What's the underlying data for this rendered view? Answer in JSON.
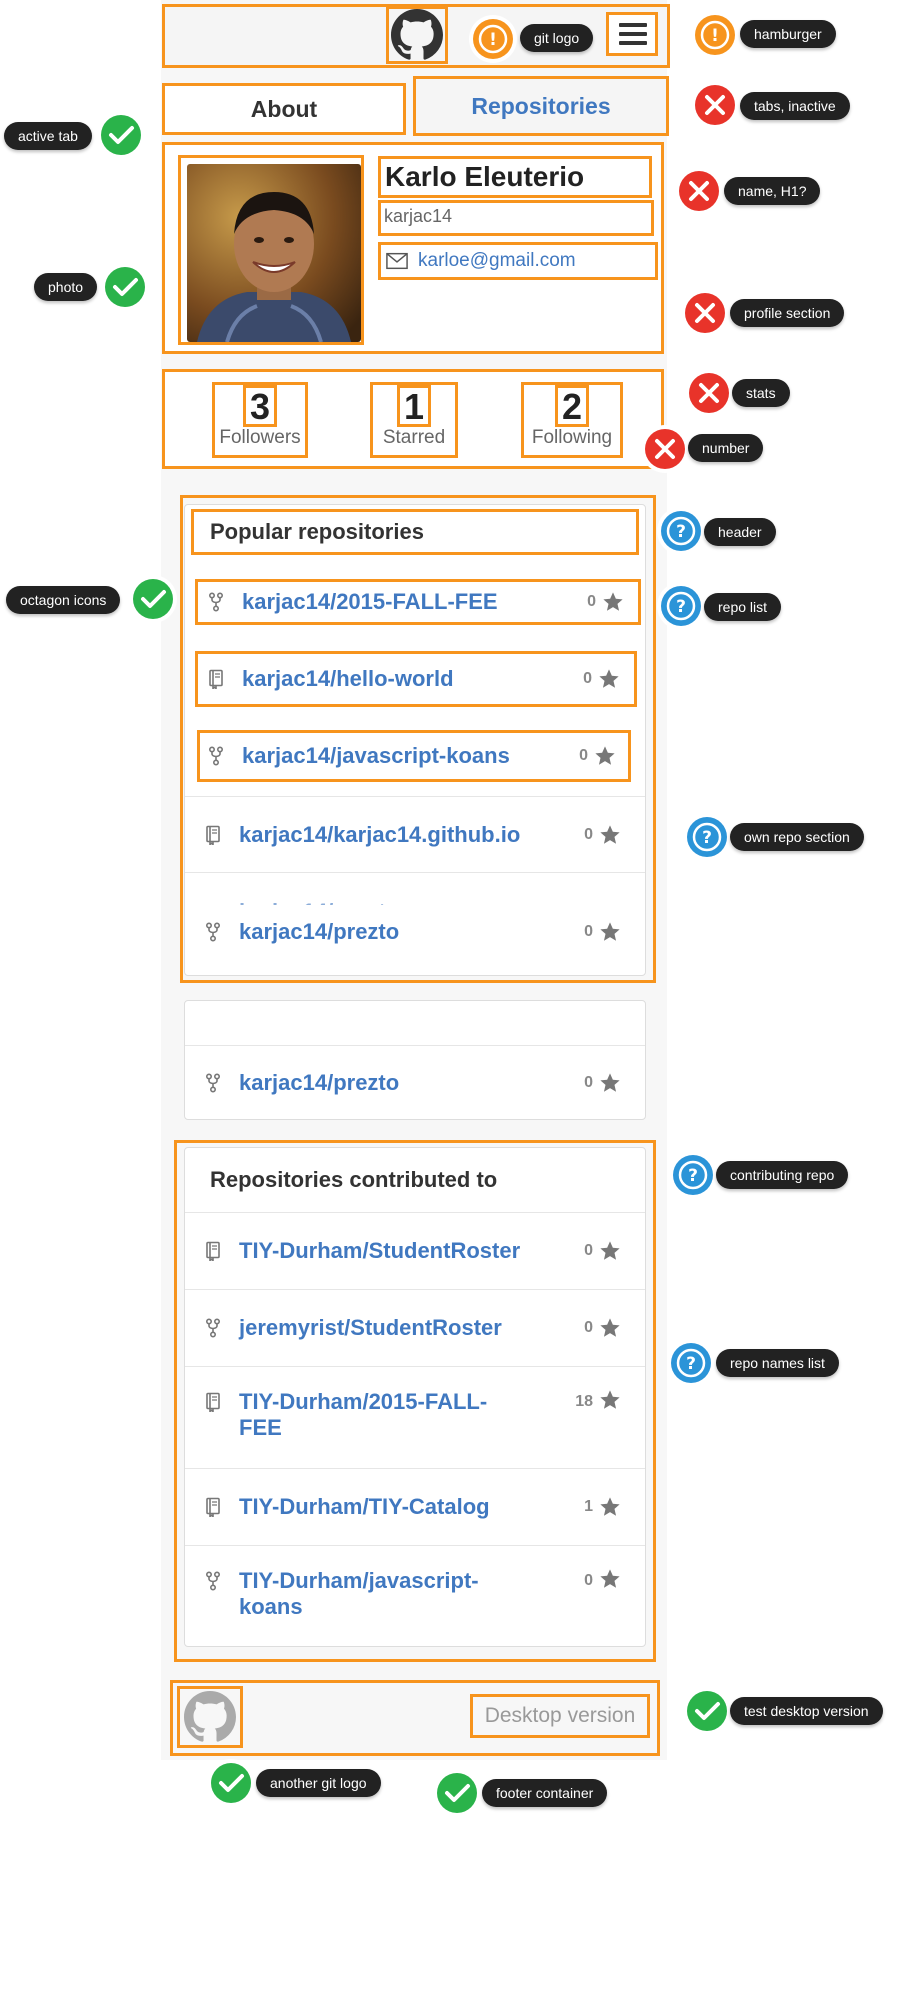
{
  "header": {
    "git_logo_icon": "github-octocat-icon",
    "menu_icon": "hamburger-icon"
  },
  "tabs": [
    {
      "label": "About",
      "active": true
    },
    {
      "label": "Repositories",
      "active": false
    }
  ],
  "profile": {
    "name": "Karlo Eleuterio",
    "username": "karjac14",
    "email": "karloe@gmail.com"
  },
  "stats": [
    {
      "value": "3",
      "label": "Followers"
    },
    {
      "value": "1",
      "label": "Starred"
    },
    {
      "value": "2",
      "label": "Following"
    }
  ],
  "popular": {
    "title": "Popular repositories",
    "repos": [
      {
        "name": "karjac14/2015-FALL-FEE",
        "stars": "0",
        "icon": "fork-icon"
      },
      {
        "name": "karjac14/hello-world",
        "stars": "0",
        "icon": "book-icon"
      },
      {
        "name": "karjac14/javascript-koans",
        "stars": "0",
        "icon": "fork-icon"
      },
      {
        "name": "karjac14/karjac14.github.io",
        "stars": "0",
        "icon": "book-icon"
      },
      {
        "name": "karjac14/prezto",
        "stars": "0",
        "icon": "fork-icon"
      }
    ],
    "ghost_repo": {
      "name": "karjac14/prezto",
      "stars": "0"
    }
  },
  "contributed": {
    "title": "Repositories contributed to",
    "repos": [
      {
        "name": "TIY-Durham/StudentRoster",
        "stars": "0",
        "icon": "book-icon"
      },
      {
        "name": "jeremyrist/StudentRoster",
        "stars": "0",
        "icon": "fork-icon"
      },
      {
        "name": "TIY-Durham/2015-FALL-FEE",
        "name_line1": "TIY-Durham/2015-FALL-",
        "name_line2": "FEE",
        "stars": "18",
        "icon": "book-icon"
      },
      {
        "name": "TIY-Durham/TIY-Catalog",
        "stars": "1",
        "icon": "book-icon"
      },
      {
        "name": "TIY-Durham/javascript-koans",
        "name_line1": "TIY-Durham/javascript-",
        "name_line2": "koans",
        "stars": "0",
        "icon": "fork-icon"
      }
    ]
  },
  "footer": {
    "logo_icon": "github-octocat-icon",
    "desktop_link": "Desktop version"
  },
  "annotations": {
    "git_logo": "git logo",
    "hamburger": "hamburger",
    "active_tab": "active tab",
    "tabs_inactive": "tabs, inactive",
    "name_h1": "name, H1?",
    "photo": "photo",
    "profile_section": "profile section",
    "stats": "stats",
    "number": "number",
    "header": "header",
    "octagon_icons": "octagon icons",
    "repo_list": "repo list",
    "own_repo_section": "own repo section",
    "contributing_repo": "contributing repo",
    "repo_names_list": "repo names list",
    "test_desktop_version": "test desktop version",
    "another_git_logo": "another git logo",
    "footer_container": "footer container"
  },
  "colors": {
    "highlight_border": "#f7941d",
    "ok": "#2ab34a",
    "warn": "#f7941d",
    "error": "#e8332a",
    "question": "#2b94d8",
    "link": "#4078c0"
  }
}
